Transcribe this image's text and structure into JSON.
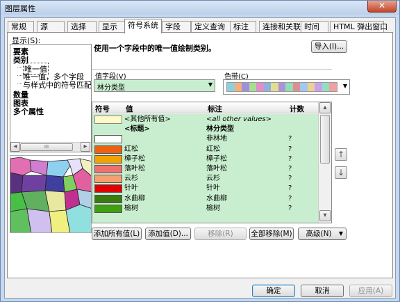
{
  "window": {
    "title": "图层属性",
    "close_glyph": "✕"
  },
  "tabs": [
    {
      "label": "常规"
    },
    {
      "label": "源"
    },
    {
      "label": "选择"
    },
    {
      "label": "显示"
    },
    {
      "label": "符号系统"
    },
    {
      "label": "字段"
    },
    {
      "label": "定义查询"
    },
    {
      "label": "标注"
    },
    {
      "label": "连接和关联"
    },
    {
      "label": "时间"
    },
    {
      "label": "HTML 弹出窗口"
    }
  ],
  "active_tab": "符号系统",
  "show_panel": {
    "label": "显示(S):",
    "items": [
      {
        "label": "要素",
        "bold": true
      },
      {
        "label": "类别",
        "bold": true
      },
      {
        "label": "唯一值",
        "selected": true
      },
      {
        "label": "唯一值，多个字段"
      },
      {
        "label": "与样式中的符号匹配"
      },
      {
        "label": "数量",
        "bold": true
      },
      {
        "label": "图表",
        "bold": true
      },
      {
        "label": "多个属性",
        "bold": true
      }
    ],
    "scroll_left": "◂",
    "scroll_right": "▸",
    "scroll_grip": "III"
  },
  "symbology": {
    "heading": "使用一个字段中的唯一值绘制类别。",
    "import_button": "导入(I)...",
    "value_field_label": "值字段(V)",
    "value_field_value": "林分类型",
    "color_ramp_label": "色带(C)",
    "color_ramp_colors": [
      "#8fd0e0",
      "#f4b07a",
      "#9d8fe0",
      "#a7df8f",
      "#e08fc9",
      "#8fb0e0",
      "#dfdf8f",
      "#b08fdf",
      "#8fdfb4",
      "#df8f8f",
      "#a0c8f0",
      "#f0d08f",
      "#c8a0f0",
      "#90e0c0",
      "#f0a0a0"
    ]
  },
  "table": {
    "headers": {
      "symbol": "符号",
      "value": "值",
      "label": "标注",
      "count": "计数"
    },
    "rows": [
      {
        "symbol": "#fff8c8",
        "value": "<其他所有值>",
        "label": "<all other values>",
        "count": "",
        "italic": true
      },
      {
        "symbol": "",
        "value": "<标题>",
        "label": "林分类型",
        "count": "",
        "bold": true
      },
      {
        "symbol": "#ffffff",
        "value": "",
        "label": "非林地",
        "count": "?"
      },
      {
        "symbol": "#f06010",
        "value": "红松",
        "label": "红松",
        "count": "?"
      },
      {
        "symbol": "#f4a000",
        "value": "樟子松",
        "label": "樟子松",
        "count": "?"
      },
      {
        "symbol": "#f07070",
        "value": "落叶松",
        "label": "落叶松",
        "count": "?"
      },
      {
        "symbol": "#f4a070",
        "value": "云杉",
        "label": "云杉",
        "count": "?"
      },
      {
        "symbol": "#e00000",
        "value": "针叶",
        "label": "针叶",
        "count": "?"
      },
      {
        "symbol": "#3a7a10",
        "value": "水曲柳",
        "label": "水曲柳",
        "count": "?"
      },
      {
        "symbol": "#40a010",
        "value": "榆树",
        "label": "榆树",
        "count": "?"
      }
    ],
    "scroll_up": "▴",
    "scroll_down": "▾"
  },
  "move_buttons": {
    "up": "↑",
    "down": "↓"
  },
  "action_buttons": {
    "add_all": "添加所有值(L)",
    "add": "添加值(D)...",
    "remove": "移除(R)",
    "remove_all": "全部移除(M)",
    "advanced": "高级(N)"
  },
  "footer_buttons": {
    "ok": "确定",
    "cancel": "取消",
    "apply": "应用(A)"
  }
}
